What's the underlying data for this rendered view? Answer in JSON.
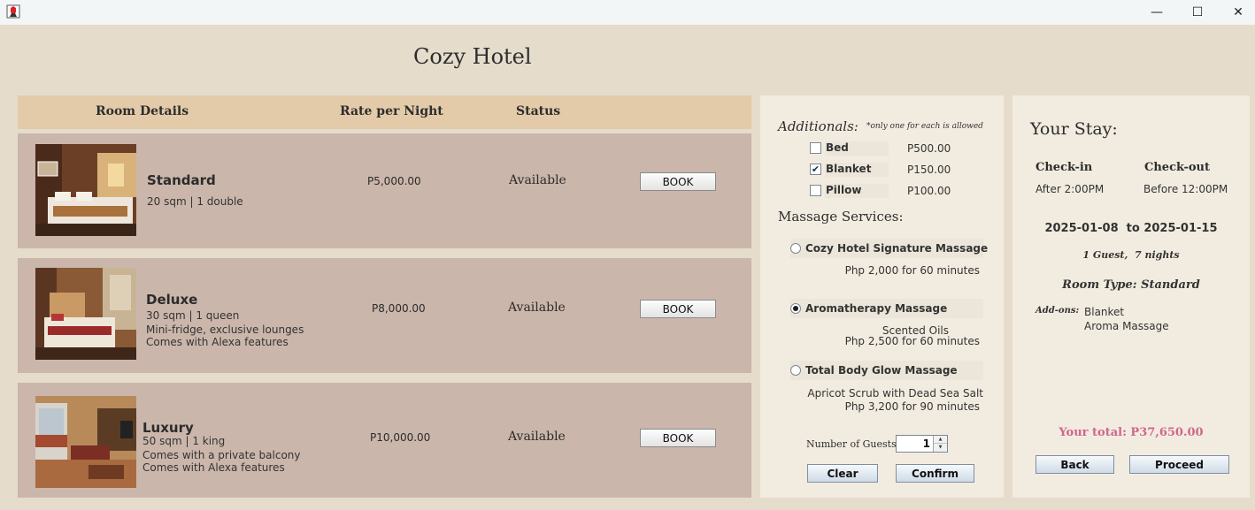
{
  "window": {
    "app_icon": "java-duke-icon",
    "minimize": "—",
    "maximize": "☐",
    "close": "✕"
  },
  "title": "Cozy Hotel",
  "table_header": {
    "room_details": "Room Details",
    "rate": "Rate per Night",
    "status": "Status"
  },
  "rooms": [
    {
      "name": "Standard",
      "details": [
        "20 sqm | 1 double"
      ],
      "rate": "P5,000.00",
      "status": "Available",
      "button": "BOOK"
    },
    {
      "name": "Deluxe",
      "details": [
        "30 sqm | 1 queen",
        "Mini-fridge, exclusive lounges",
        "Comes with Alexa features"
      ],
      "rate": "P8,000.00",
      "status": "Available",
      "button": "BOOK"
    },
    {
      "name": "Luxury",
      "details": [
        "50 sqm | 1 king",
        "Comes with a private balcony",
        "Comes with Alexa features"
      ],
      "rate": "P10,000.00",
      "status": "Available",
      "button": "BOOK"
    }
  ],
  "additionals": {
    "title": "Additionals:",
    "note": "*only one for each is allowed",
    "items": [
      {
        "label": "Bed",
        "price": "P500.00",
        "checked": false
      },
      {
        "label": "Blanket",
        "price": "P150.00",
        "checked": true
      },
      {
        "label": "Pillow",
        "price": "P100.00",
        "checked": false
      }
    ],
    "check_mark": "✔"
  },
  "massage": {
    "title": "Massage Services:",
    "options": [
      {
        "label": "Cozy Hotel Signature Massage",
        "lines": [
          "Php 2,000 for 60 minutes"
        ],
        "selected": false
      },
      {
        "label": "Aromatherapy Massage",
        "lines": [
          "Scented Oils",
          "Php 2,500 for 60 minutes"
        ],
        "selected": true
      },
      {
        "label": "Total Body Glow Massage",
        "lines": [
          "Apricot Scrub with Dead Sea Salt",
          "Php 3,200 for 90 minutes"
        ],
        "selected": false
      }
    ]
  },
  "guests": {
    "label": "Number of Guests:",
    "value": "1",
    "up": "▲",
    "down": "▼"
  },
  "buttons": {
    "clear": "Clear",
    "confirm": "Confirm",
    "back": "Back",
    "proceed": "Proceed"
  },
  "stay": {
    "title": "Your Stay:",
    "checkin_label": "Check-in",
    "checkin_value": "After 2:00PM",
    "checkout_label": "Check-out",
    "checkout_value": "Before 12:00PM",
    "dates": "2025-01-08  to 2025-01-15",
    "guests_nights": "1 Guest,  7 nights",
    "room_type": "Room Type: Standard",
    "addons_label": "Add-ons:",
    "addons": [
      "Blanket",
      "Aroma Massage"
    ],
    "total": "Your total: P37,650.00"
  },
  "colors": {
    "background": "#e5dccb",
    "header": "#e3cba9",
    "row": "#cbb6ab",
    "panel": "#f2ece0",
    "total": "#d0668b"
  }
}
